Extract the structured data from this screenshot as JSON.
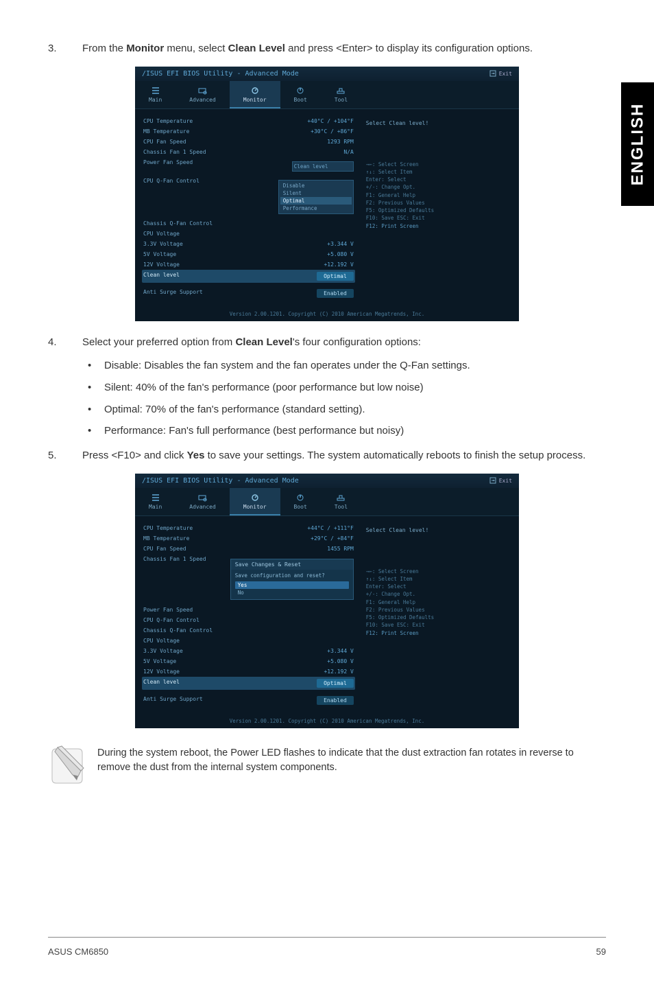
{
  "sideTab": "ENGLISH",
  "step3": {
    "num": "3.",
    "text_a": "From the ",
    "b1": "Monitor",
    "text_b": " menu, select ",
    "b2": "Clean Level",
    "text_c": " and press <Enter> to display its configuration options."
  },
  "step4": {
    "num": "4.",
    "text_a": "Select your preferred option from ",
    "b1": "Clean Level",
    "text_b": "'s four configuration options:"
  },
  "bullets": [
    "Disable: Disables the fan system and the fan operates under the Q-Fan settings.",
    "Silent: 40% of the fan's performance (poor performance but low noise)",
    "Optimal: 70% of the fan's performance (standard setting).",
    "Performance: Fan's full performance (best performance but noisy)"
  ],
  "step5": {
    "num": "5.",
    "text_a": "Press <F10> and click ",
    "b1": "Yes",
    "text_b": " to save your settings. The system automatically reboots to finish the setup process."
  },
  "note": "During the system reboot, the Power LED flashes to indicate that the dust extraction fan rotates in reverse to remove the dust from the internal system components.",
  "footer": {
    "left": "ASUS CM6850",
    "right": "59"
  },
  "bios": {
    "title": "/ISUS EFI BIOS Utility - Advanced Mode",
    "exit": "Exit",
    "tabs": {
      "main": "Main",
      "advanced": "Advanced",
      "monitor": "Monitor",
      "boot": "Boot",
      "tool": "Tool"
    },
    "rows1": {
      "cpuTemp": {
        "l": "CPU Temperature",
        "v": "+40°C / +104°F"
      },
      "mbTemp": {
        "l": "MB Temperature",
        "v": "+30°C / +86°F"
      },
      "cpuFan": {
        "l": "CPU Fan Speed",
        "v": "1293 RPM"
      },
      "chFan": {
        "l": "Chassis Fan 1 Speed",
        "v": "N/A"
      },
      "pwrFan": {
        "l": "Power Fan Speed",
        "v": ""
      },
      "cpuQ": {
        "l": "CPU Q-Fan Control"
      },
      "chQ": {
        "l": "Chassis Q-Fan Control"
      },
      "cpuV": {
        "l": "CPU Voltage"
      },
      "v33": {
        "l": "3.3V Voltage",
        "v": "+3.344 V"
      },
      "v5": {
        "l": "5V Voltage",
        "v": "+5.080 V"
      },
      "v12": {
        "l": "12V Voltage",
        "v": "+12.192 V"
      },
      "clean": {
        "l": "Clean level",
        "v": "Optimal"
      },
      "anti": {
        "l": "Anti Surge Support",
        "v": "Enabled"
      }
    },
    "dropdown1": {
      "title": "Clean level",
      "items": [
        "Disable",
        "Silent",
        "Optimal",
        "Performance"
      ],
      "hi": "Optimal"
    },
    "rows2_cpuTemp": "+44°C / +111°F",
    "rows2_mbTemp": "+29°C / +84°F",
    "rows2_cpuFan": "1455 RPM",
    "dialog": {
      "title": "Save Changes & Reset",
      "body": "Save configuration and reset?",
      "yes": "Yes",
      "no": "No"
    },
    "help_title": "Select Clean level!",
    "help": {
      "h1": "→←: Select Screen",
      "h2": "↑↓: Select Item",
      "h3": "Enter: Select",
      "h4": "+/-: Change Opt.",
      "h5": "F1: General Help",
      "h6": "F2: Previous Values",
      "h7": "F5: Optimized Defaults",
      "h8": "F10: Save  ESC: Exit",
      "h9": "F12: Print Screen"
    },
    "version": "Version 2.00.1201. Copyright (C) 2010 American Megatrends, Inc."
  },
  "chart_data": [
    {
      "type": "table",
      "title": "BIOS Monitor readings (screenshot 1)",
      "rows": [
        [
          "CPU Temperature",
          "+40°C / +104°F"
        ],
        [
          "MB Temperature",
          "+30°C / +86°F"
        ],
        [
          "CPU Fan Speed",
          "1293 RPM"
        ],
        [
          "Chassis Fan 1 Speed",
          "N/A"
        ],
        [
          "3.3V Voltage",
          "+3.344 V"
        ],
        [
          "5V Voltage",
          "+5.080 V"
        ],
        [
          "12V Voltage",
          "+12.192 V"
        ],
        [
          "Clean level",
          "Optimal"
        ],
        [
          "Anti Surge Support",
          "Enabled"
        ]
      ]
    },
    {
      "type": "table",
      "title": "BIOS Monitor readings (screenshot 2)",
      "rows": [
        [
          "CPU Temperature",
          "+44°C / +111°F"
        ],
        [
          "MB Temperature",
          "+29°C / +84°F"
        ],
        [
          "CPU Fan Speed",
          "1455 RPM"
        ],
        [
          "3.3V Voltage",
          "+3.344 V"
        ],
        [
          "5V Voltage",
          "+5.080 V"
        ],
        [
          "12V Voltage",
          "+12.192 V"
        ],
        [
          "Clean level",
          "Optimal"
        ],
        [
          "Anti Surge Support",
          "Enabled"
        ]
      ]
    }
  ]
}
